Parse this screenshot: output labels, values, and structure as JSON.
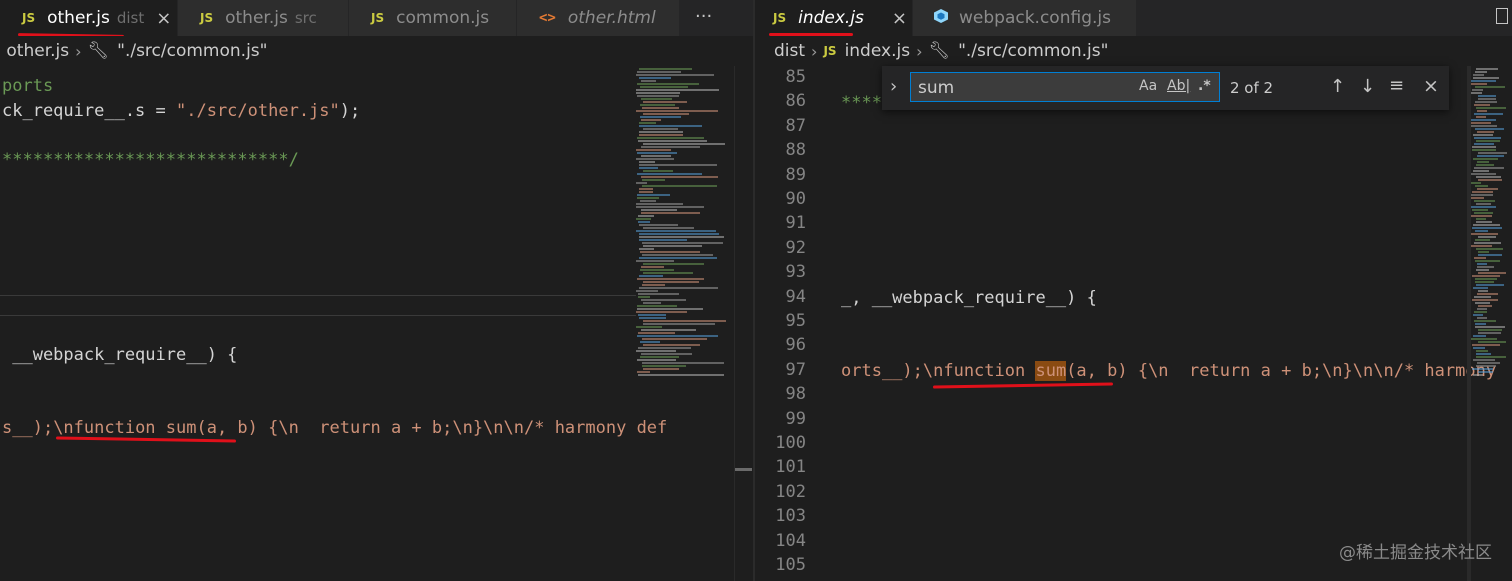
{
  "left_pane": {
    "tabs": [
      {
        "icon": "JS",
        "label": "other.js",
        "sublabel": "dist",
        "close": "×"
      },
      {
        "icon": "JS",
        "label": "other.js",
        "sublabel": "src"
      },
      {
        "icon": "JS",
        "label": "common.js"
      },
      {
        "icon": "<>",
        "label": "other.html"
      }
    ],
    "more": "···",
    "breadcrumb": {
      "file": "other.js",
      "symbol": "\"./src/common.js\""
    },
    "code": {
      "l1": "ports",
      "l2a": "ck_require__.s = ",
      "l2b": "\"./src/other.js\"",
      "l2c": ");",
      "l3": "****************************/",
      "l4": " __webpack_require__) {",
      "l5a": "s__);",
      "l5b": "\\nfunction sum(a, b) {\\n  return a + b;\\n}\\n\\n/* harmony def"
    }
  },
  "right_pane": {
    "tabs": [
      {
        "icon": "JS",
        "label": "index.js",
        "close": "×"
      },
      {
        "icon": "webpack-cube",
        "label": "webpack.config.js"
      }
    ],
    "breadcrumb": {
      "folder": "dist",
      "file": "index.js",
      "symbol": "\"./src/common.js\""
    },
    "line_numbers": [
      "85",
      "86",
      "87",
      "88",
      "89",
      "90",
      "91",
      "92",
      "93",
      "94",
      "95",
      "96",
      "97",
      "98",
      "99",
      "100",
      "101",
      "102",
      "103",
      "104",
      "105"
    ],
    "code": {
      "l86": "****",
      "l94": "_, __webpack_require__) {",
      "l97a": "orts__);\\nfunction ",
      "l97b": "sum",
      "l97c": "(a, b) {\\n  return a + b;\\n}\\n\\n/* harmony"
    },
    "find_widget": {
      "query": "sum",
      "match_case": "Aa",
      "whole_word": "Ab|",
      "regex": ".*",
      "result": "2 of 2",
      "prev": "↑",
      "next": "↓",
      "selection": "≡",
      "close": "×",
      "toggle": "›"
    }
  },
  "watermark": "@稀土掘金技术社区",
  "colors": {
    "editor_bg": "#1e1e1e",
    "tab_bg": "#2d2d2d",
    "js_icon": "#cbcb41",
    "string": "#ce9178",
    "comment": "#6a9955",
    "annotation": "#e0101a"
  }
}
